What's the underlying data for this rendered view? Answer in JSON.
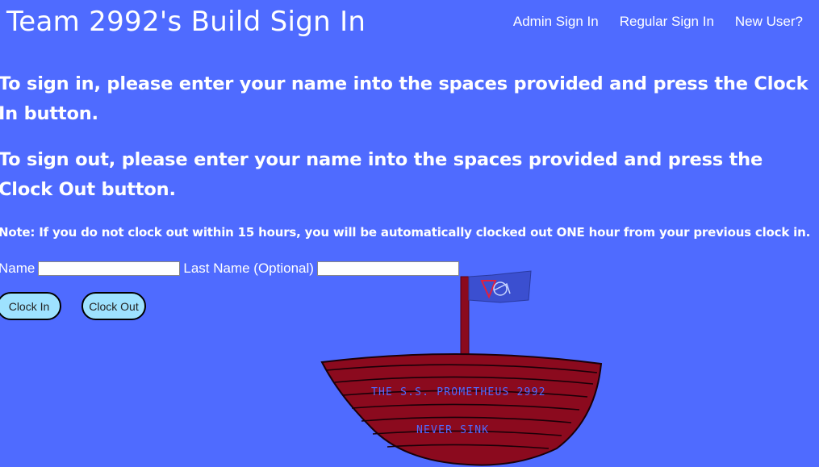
{
  "header": {
    "title": "Team 2992's Build Sign In",
    "nav": [
      "Admin Sign In",
      "Regular Sign In",
      "New User?"
    ]
  },
  "instructions": {
    "sign_in": "To sign in, please enter your name into the spaces provided and press the Clock In button.",
    "sign_out": "To sign out, please enter your name into the spaces provided and press the Clock Out button.",
    "note": "Note: If you do not clock out within 15 hours, you will be automatically clocked out ONE hour from your previous clock in."
  },
  "form": {
    "name_label": "Name",
    "name_value": "",
    "last_name_label": "Last Name (Optional)",
    "last_name_value": "",
    "clock_in_label": "Clock In",
    "clock_out_label": "Clock Out"
  },
  "ship": {
    "hull_text_1": "THE S.S. PROMETHEUS 2992",
    "hull_text_2": "NEVER SINK"
  },
  "colors": {
    "background": "#4f6bff",
    "button": "#9ee2ff",
    "hull": "#8b0a1e",
    "flag": "#3b4fd0"
  }
}
